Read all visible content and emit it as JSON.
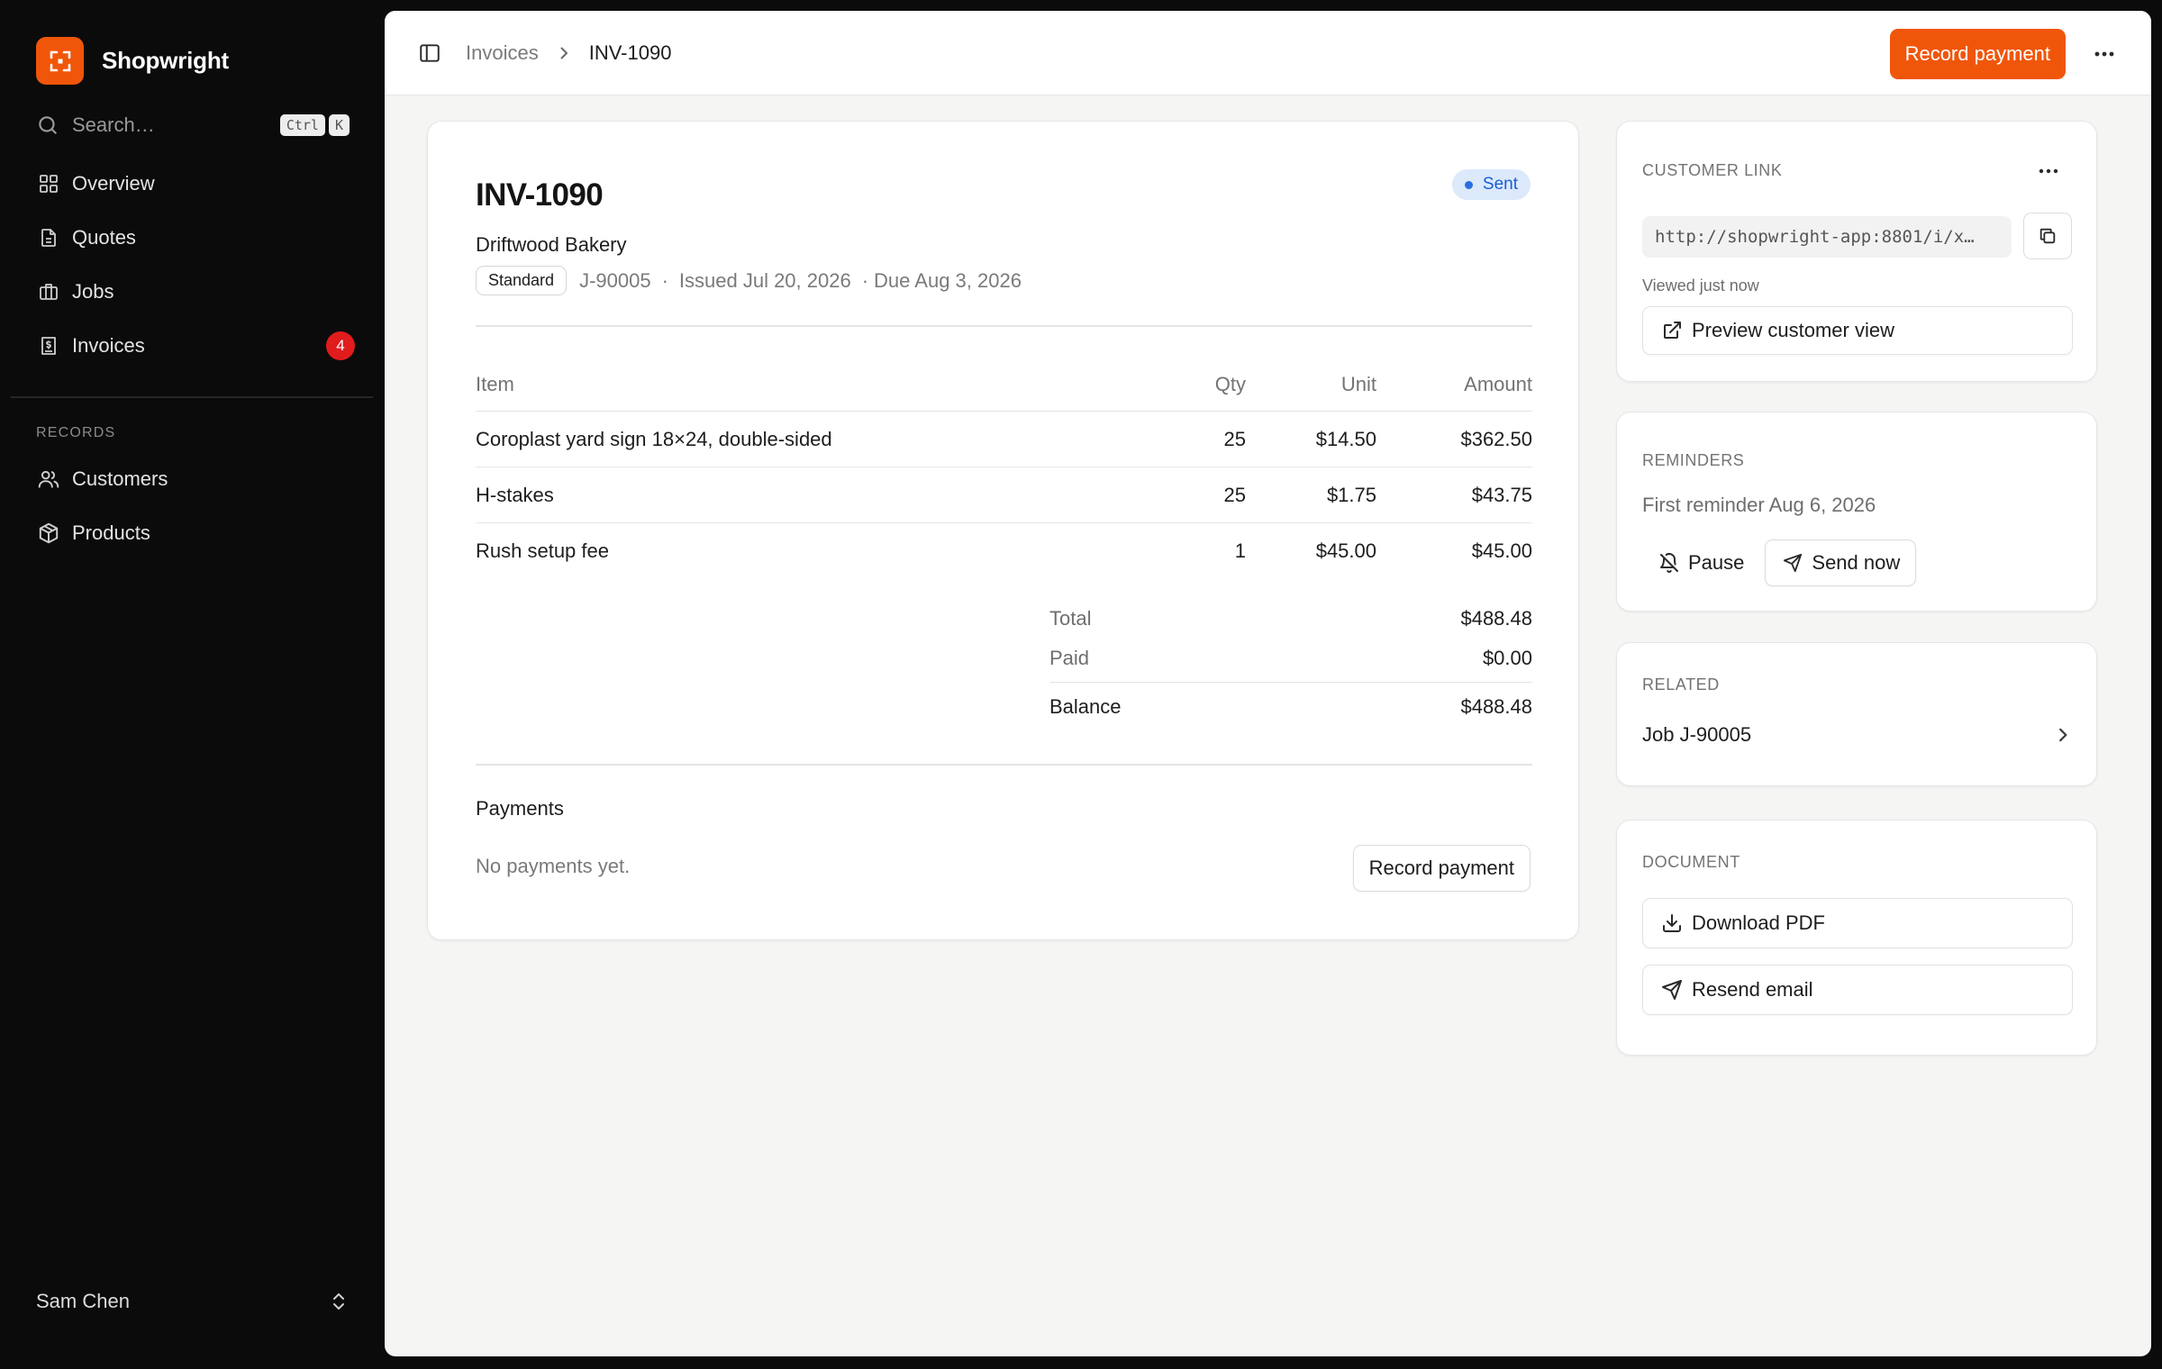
{
  "app": {
    "name": "Shopwright",
    "colors": {
      "accent": "#f0560a",
      "badge": "#e01c1c",
      "status_sent_bg": "#dbe9fb",
      "status_sent_text": "#1b5fd1"
    }
  },
  "sidebar": {
    "search": {
      "placeholder": "Search…",
      "shortcut": [
        "Ctrl",
        "K"
      ]
    },
    "nav": [
      {
        "label": "Overview",
        "icon": "grid-icon"
      },
      {
        "label": "Quotes",
        "icon": "document-icon"
      },
      {
        "label": "Jobs",
        "icon": "briefcase-icon"
      },
      {
        "label": "Invoices",
        "icon": "invoice-icon",
        "badge": "4"
      }
    ],
    "section_label": "RECORDS",
    "records": [
      {
        "label": "Customers",
        "icon": "users-icon"
      },
      {
        "label": "Products",
        "icon": "box-icon"
      }
    ],
    "user": {
      "name": "Sam Chen"
    }
  },
  "topbar": {
    "breadcrumb": {
      "parent": "Invoices",
      "current": "INV-1090"
    },
    "primary_action": "Record payment"
  },
  "invoice": {
    "number": "INV-1090",
    "status": "Sent",
    "customer": "Driftwood Bakery",
    "type": "Standard",
    "job": "J-90005",
    "issued": "Issued Jul 20, 2026",
    "due": "Due Aug 3, 2026",
    "columns": {
      "item": "Item",
      "qty": "Qty",
      "unit": "Unit",
      "amount": "Amount"
    },
    "items": [
      {
        "item": "Coroplast yard sign 18×24, double-sided",
        "qty": "25",
        "unit": "$14.50",
        "amount": "$362.50"
      },
      {
        "item": "H-stakes",
        "qty": "25",
        "unit": "$1.75",
        "amount": "$43.75"
      },
      {
        "item": "Rush setup fee",
        "qty": "1",
        "unit": "$45.00",
        "amount": "$45.00"
      }
    ],
    "totals": {
      "total_label": "Total",
      "total": "$488.48",
      "paid_label": "Paid",
      "paid": "$0.00",
      "balance_label": "Balance",
      "balance": "$488.48"
    },
    "payments": {
      "title": "Payments",
      "empty": "No payments yet.",
      "action": "Record payment"
    }
  },
  "customer_link": {
    "label": "CUSTOMER LINK",
    "url": "http://shopwright-app:8801/i/x…",
    "viewed": "Viewed just now",
    "preview": "Preview customer view"
  },
  "reminders": {
    "label": "REMINDERS",
    "text": "First reminder Aug 6, 2026",
    "pause": "Pause",
    "send_now": "Send now"
  },
  "related": {
    "label": "RELATED",
    "job": "Job J-90005"
  },
  "document": {
    "label": "DOCUMENT",
    "download": "Download PDF",
    "resend": "Resend email"
  }
}
